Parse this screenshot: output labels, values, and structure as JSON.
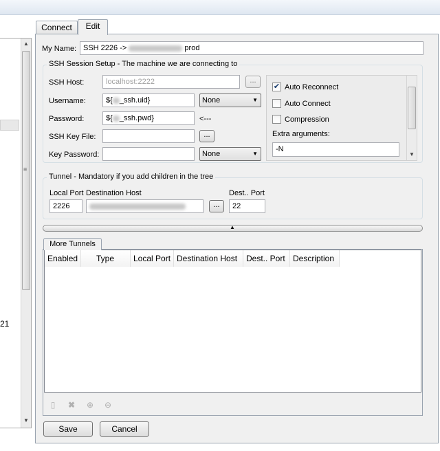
{
  "tabs": [
    {
      "label": "Connect",
      "active": false
    },
    {
      "label": "Edit",
      "active": true
    }
  ],
  "my_name": {
    "label": "My Name:",
    "value_prefix": "SSH 2226 ->",
    "value_suffix": "prod"
  },
  "ssh_group": {
    "title": "SSH Session Setup - The machine we are connecting to",
    "host_label": "SSH Host:",
    "host_placeholder": "localhost:2222",
    "username_label": "Username:",
    "username_prefix": "${",
    "username_suffix": "_ssh.uid}",
    "password_label": "Password:",
    "password_prefix": "${",
    "password_suffix": "_ssh.pwd}",
    "password_note": "<---",
    "keyfile_label": "SSH Key File:",
    "keypass_label": "Key Password:",
    "username_combo": "None",
    "keypass_combo": "None",
    "browse_label": "..."
  },
  "options": {
    "auto_reconnect": {
      "label": "Auto Reconnect",
      "checked": true
    },
    "auto_connect": {
      "label": "Auto Connect",
      "checked": false
    },
    "compression": {
      "label": "Compression",
      "checked": false
    },
    "extra_label": "Extra arguments:",
    "extra_value": "-N"
  },
  "tunnel_group": {
    "title": "Tunnel - Mandatory if you add children in the tree",
    "local_port_label": "Local Port",
    "local_port_value": "2226",
    "dest_host_label": "Destination Host",
    "dest_port_label": "Dest.. Port",
    "dest_port_value": "22",
    "browse_label": "..."
  },
  "more_tunnels": {
    "tab_label": "More Tunnels",
    "columns": [
      "Enabled",
      "Type",
      "Local Port",
      "Destination Host",
      "Dest.. Port",
      "Description"
    ]
  },
  "left_panel": {
    "number": "21"
  },
  "buttons": {
    "save": "Save",
    "cancel": "Cancel"
  },
  "icons": {
    "new": "new-tunnel-icon",
    "delete": "delete-tunnel-icon",
    "up": "move-up-icon",
    "down": "move-down-icon"
  },
  "colors": {
    "checkmark": "#1a3c6e",
    "tab_border": "#9aa4b0",
    "panel_bg": "#f0f0f0"
  }
}
